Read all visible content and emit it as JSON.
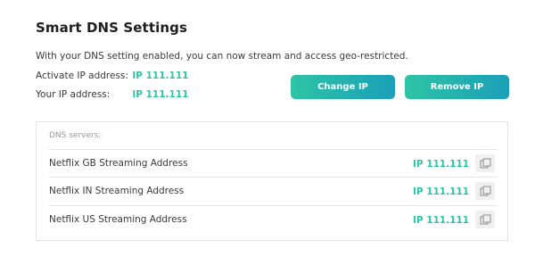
{
  "header": {
    "title": "Smart DNS Settings",
    "intro": "With your DNS setting enabled, you can now stream and access geo-restricted."
  },
  "info": {
    "activate_label": "Activate IP address:",
    "activate_value": "IP 111.111",
    "your_label": "Your IP address:",
    "your_value": "IP 111.111"
  },
  "actions": {
    "change_label": "Change IP",
    "remove_label": "Remove IP"
  },
  "dns": {
    "heading": "DNS servers:",
    "servers": [
      {
        "name": "Netflix GB Streaming Address",
        "ip": "IP 111.111",
        "icon": "copy-icon"
      },
      {
        "name": "Netflix IN Streaming Address",
        "ip": "IP 111.111",
        "icon": "copy-icon"
      },
      {
        "name": "Netflix US Streaming Address",
        "ip": "IP 111.111",
        "icon": "copy-icon"
      }
    ]
  },
  "colors": {
    "accent": "#2ec4a5",
    "gradient_start": "#2ec4a5",
    "gradient_end": "#1a9fb9"
  }
}
